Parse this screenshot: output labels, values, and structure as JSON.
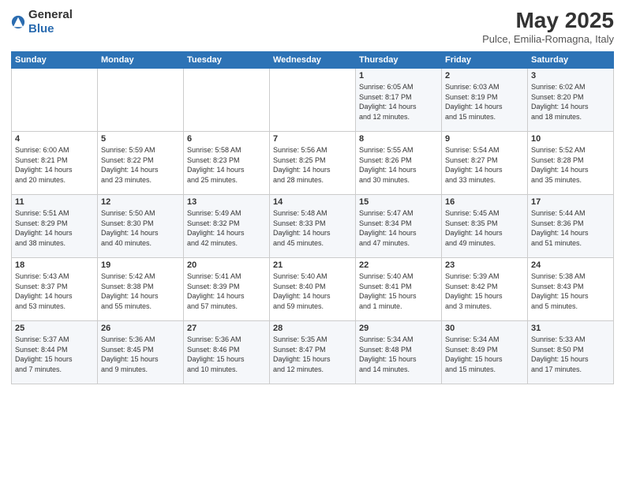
{
  "header": {
    "logo_general": "General",
    "logo_blue": "Blue",
    "month_title": "May 2025",
    "subtitle": "Pulce, Emilia-Romagna, Italy"
  },
  "days_of_week": [
    "Sunday",
    "Monday",
    "Tuesday",
    "Wednesday",
    "Thursday",
    "Friday",
    "Saturday"
  ],
  "weeks": [
    [
      {
        "day": "",
        "info": ""
      },
      {
        "day": "",
        "info": ""
      },
      {
        "day": "",
        "info": ""
      },
      {
        "day": "",
        "info": ""
      },
      {
        "day": "1",
        "info": "Sunrise: 6:05 AM\nSunset: 8:17 PM\nDaylight: 14 hours\nand 12 minutes."
      },
      {
        "day": "2",
        "info": "Sunrise: 6:03 AM\nSunset: 8:19 PM\nDaylight: 14 hours\nand 15 minutes."
      },
      {
        "day": "3",
        "info": "Sunrise: 6:02 AM\nSunset: 8:20 PM\nDaylight: 14 hours\nand 18 minutes."
      }
    ],
    [
      {
        "day": "4",
        "info": "Sunrise: 6:00 AM\nSunset: 8:21 PM\nDaylight: 14 hours\nand 20 minutes."
      },
      {
        "day": "5",
        "info": "Sunrise: 5:59 AM\nSunset: 8:22 PM\nDaylight: 14 hours\nand 23 minutes."
      },
      {
        "day": "6",
        "info": "Sunrise: 5:58 AM\nSunset: 8:23 PM\nDaylight: 14 hours\nand 25 minutes."
      },
      {
        "day": "7",
        "info": "Sunrise: 5:56 AM\nSunset: 8:25 PM\nDaylight: 14 hours\nand 28 minutes."
      },
      {
        "day": "8",
        "info": "Sunrise: 5:55 AM\nSunset: 8:26 PM\nDaylight: 14 hours\nand 30 minutes."
      },
      {
        "day": "9",
        "info": "Sunrise: 5:54 AM\nSunset: 8:27 PM\nDaylight: 14 hours\nand 33 minutes."
      },
      {
        "day": "10",
        "info": "Sunrise: 5:52 AM\nSunset: 8:28 PM\nDaylight: 14 hours\nand 35 minutes."
      }
    ],
    [
      {
        "day": "11",
        "info": "Sunrise: 5:51 AM\nSunset: 8:29 PM\nDaylight: 14 hours\nand 38 minutes."
      },
      {
        "day": "12",
        "info": "Sunrise: 5:50 AM\nSunset: 8:30 PM\nDaylight: 14 hours\nand 40 minutes."
      },
      {
        "day": "13",
        "info": "Sunrise: 5:49 AM\nSunset: 8:32 PM\nDaylight: 14 hours\nand 42 minutes."
      },
      {
        "day": "14",
        "info": "Sunrise: 5:48 AM\nSunset: 8:33 PM\nDaylight: 14 hours\nand 45 minutes."
      },
      {
        "day": "15",
        "info": "Sunrise: 5:47 AM\nSunset: 8:34 PM\nDaylight: 14 hours\nand 47 minutes."
      },
      {
        "day": "16",
        "info": "Sunrise: 5:45 AM\nSunset: 8:35 PM\nDaylight: 14 hours\nand 49 minutes."
      },
      {
        "day": "17",
        "info": "Sunrise: 5:44 AM\nSunset: 8:36 PM\nDaylight: 14 hours\nand 51 minutes."
      }
    ],
    [
      {
        "day": "18",
        "info": "Sunrise: 5:43 AM\nSunset: 8:37 PM\nDaylight: 14 hours\nand 53 minutes."
      },
      {
        "day": "19",
        "info": "Sunrise: 5:42 AM\nSunset: 8:38 PM\nDaylight: 14 hours\nand 55 minutes."
      },
      {
        "day": "20",
        "info": "Sunrise: 5:41 AM\nSunset: 8:39 PM\nDaylight: 14 hours\nand 57 minutes."
      },
      {
        "day": "21",
        "info": "Sunrise: 5:40 AM\nSunset: 8:40 PM\nDaylight: 14 hours\nand 59 minutes."
      },
      {
        "day": "22",
        "info": "Sunrise: 5:40 AM\nSunset: 8:41 PM\nDaylight: 15 hours\nand 1 minute."
      },
      {
        "day": "23",
        "info": "Sunrise: 5:39 AM\nSunset: 8:42 PM\nDaylight: 15 hours\nand 3 minutes."
      },
      {
        "day": "24",
        "info": "Sunrise: 5:38 AM\nSunset: 8:43 PM\nDaylight: 15 hours\nand 5 minutes."
      }
    ],
    [
      {
        "day": "25",
        "info": "Sunrise: 5:37 AM\nSunset: 8:44 PM\nDaylight: 15 hours\nand 7 minutes."
      },
      {
        "day": "26",
        "info": "Sunrise: 5:36 AM\nSunset: 8:45 PM\nDaylight: 15 hours\nand 9 minutes."
      },
      {
        "day": "27",
        "info": "Sunrise: 5:36 AM\nSunset: 8:46 PM\nDaylight: 15 hours\nand 10 minutes."
      },
      {
        "day": "28",
        "info": "Sunrise: 5:35 AM\nSunset: 8:47 PM\nDaylight: 15 hours\nand 12 minutes."
      },
      {
        "day": "29",
        "info": "Sunrise: 5:34 AM\nSunset: 8:48 PM\nDaylight: 15 hours\nand 14 minutes."
      },
      {
        "day": "30",
        "info": "Sunrise: 5:34 AM\nSunset: 8:49 PM\nDaylight: 15 hours\nand 15 minutes."
      },
      {
        "day": "31",
        "info": "Sunrise: 5:33 AM\nSunset: 8:50 PM\nDaylight: 15 hours\nand 17 minutes."
      }
    ]
  ]
}
